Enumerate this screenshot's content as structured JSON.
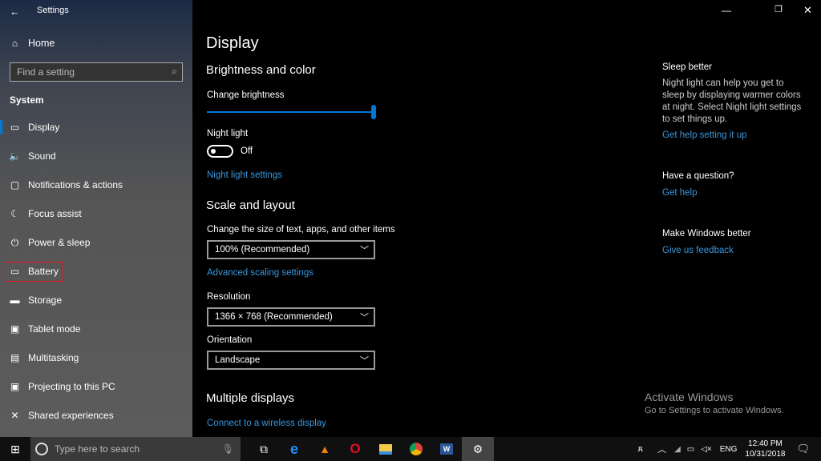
{
  "window": {
    "title": "Settings"
  },
  "sidebar": {
    "home": "Home",
    "search_placeholder": "Find a setting",
    "section": "System",
    "items": [
      {
        "label": "Display",
        "icon": "monitor-icon"
      },
      {
        "label": "Sound",
        "icon": "speaker-icon"
      },
      {
        "label": "Notifications & actions",
        "icon": "notification-icon"
      },
      {
        "label": "Focus assist",
        "icon": "moon-icon"
      },
      {
        "label": "Power & sleep",
        "icon": "power-icon"
      },
      {
        "label": "Battery",
        "icon": "battery-icon"
      },
      {
        "label": "Storage",
        "icon": "storage-icon"
      },
      {
        "label": "Tablet mode",
        "icon": "tablet-icon"
      },
      {
        "label": "Multitasking",
        "icon": "multitasking-icon"
      },
      {
        "label": "Projecting to this PC",
        "icon": "projector-icon"
      },
      {
        "label": "Shared experiences",
        "icon": "shared-icon"
      }
    ]
  },
  "main": {
    "title": "Display",
    "brightness_heading": "Brightness and color",
    "brightness_label": "Change brightness",
    "brightness_value": 100,
    "night_light_label": "Night light",
    "night_light_state": "Off",
    "night_light_link": "Night light settings",
    "scale_heading": "Scale and layout",
    "scale_label": "Change the size of text, apps, and other items",
    "scale_value": "100% (Recommended)",
    "advanced_link": "Advanced scaling settings",
    "resolution_label": "Resolution",
    "resolution_value": "1366 × 768 (Recommended)",
    "orientation_label": "Orientation",
    "orientation_value": "Landscape",
    "multiple_heading": "Multiple displays",
    "wireless_link": "Connect to a wireless display"
  },
  "aside": {
    "sleep_title": "Sleep better",
    "sleep_text": "Night light can help you get to sleep by displaying warmer colors at night. Select Night light settings to set things up.",
    "sleep_link": "Get help setting it up",
    "question_title": "Have a question?",
    "question_link": "Get help",
    "better_title": "Make Windows better",
    "better_link": "Give us feedback"
  },
  "watermark": {
    "title": "Activate Windows",
    "text": "Go to Settings to activate Windows."
  },
  "taskbar": {
    "search_placeholder": "Type here to search",
    "lang": "ENG",
    "time": "12:40 PM",
    "date": "10/31/2018"
  },
  "colors": {
    "accent": "#0078d7",
    "link": "#3a96dd",
    "highlight": "#e81123"
  }
}
